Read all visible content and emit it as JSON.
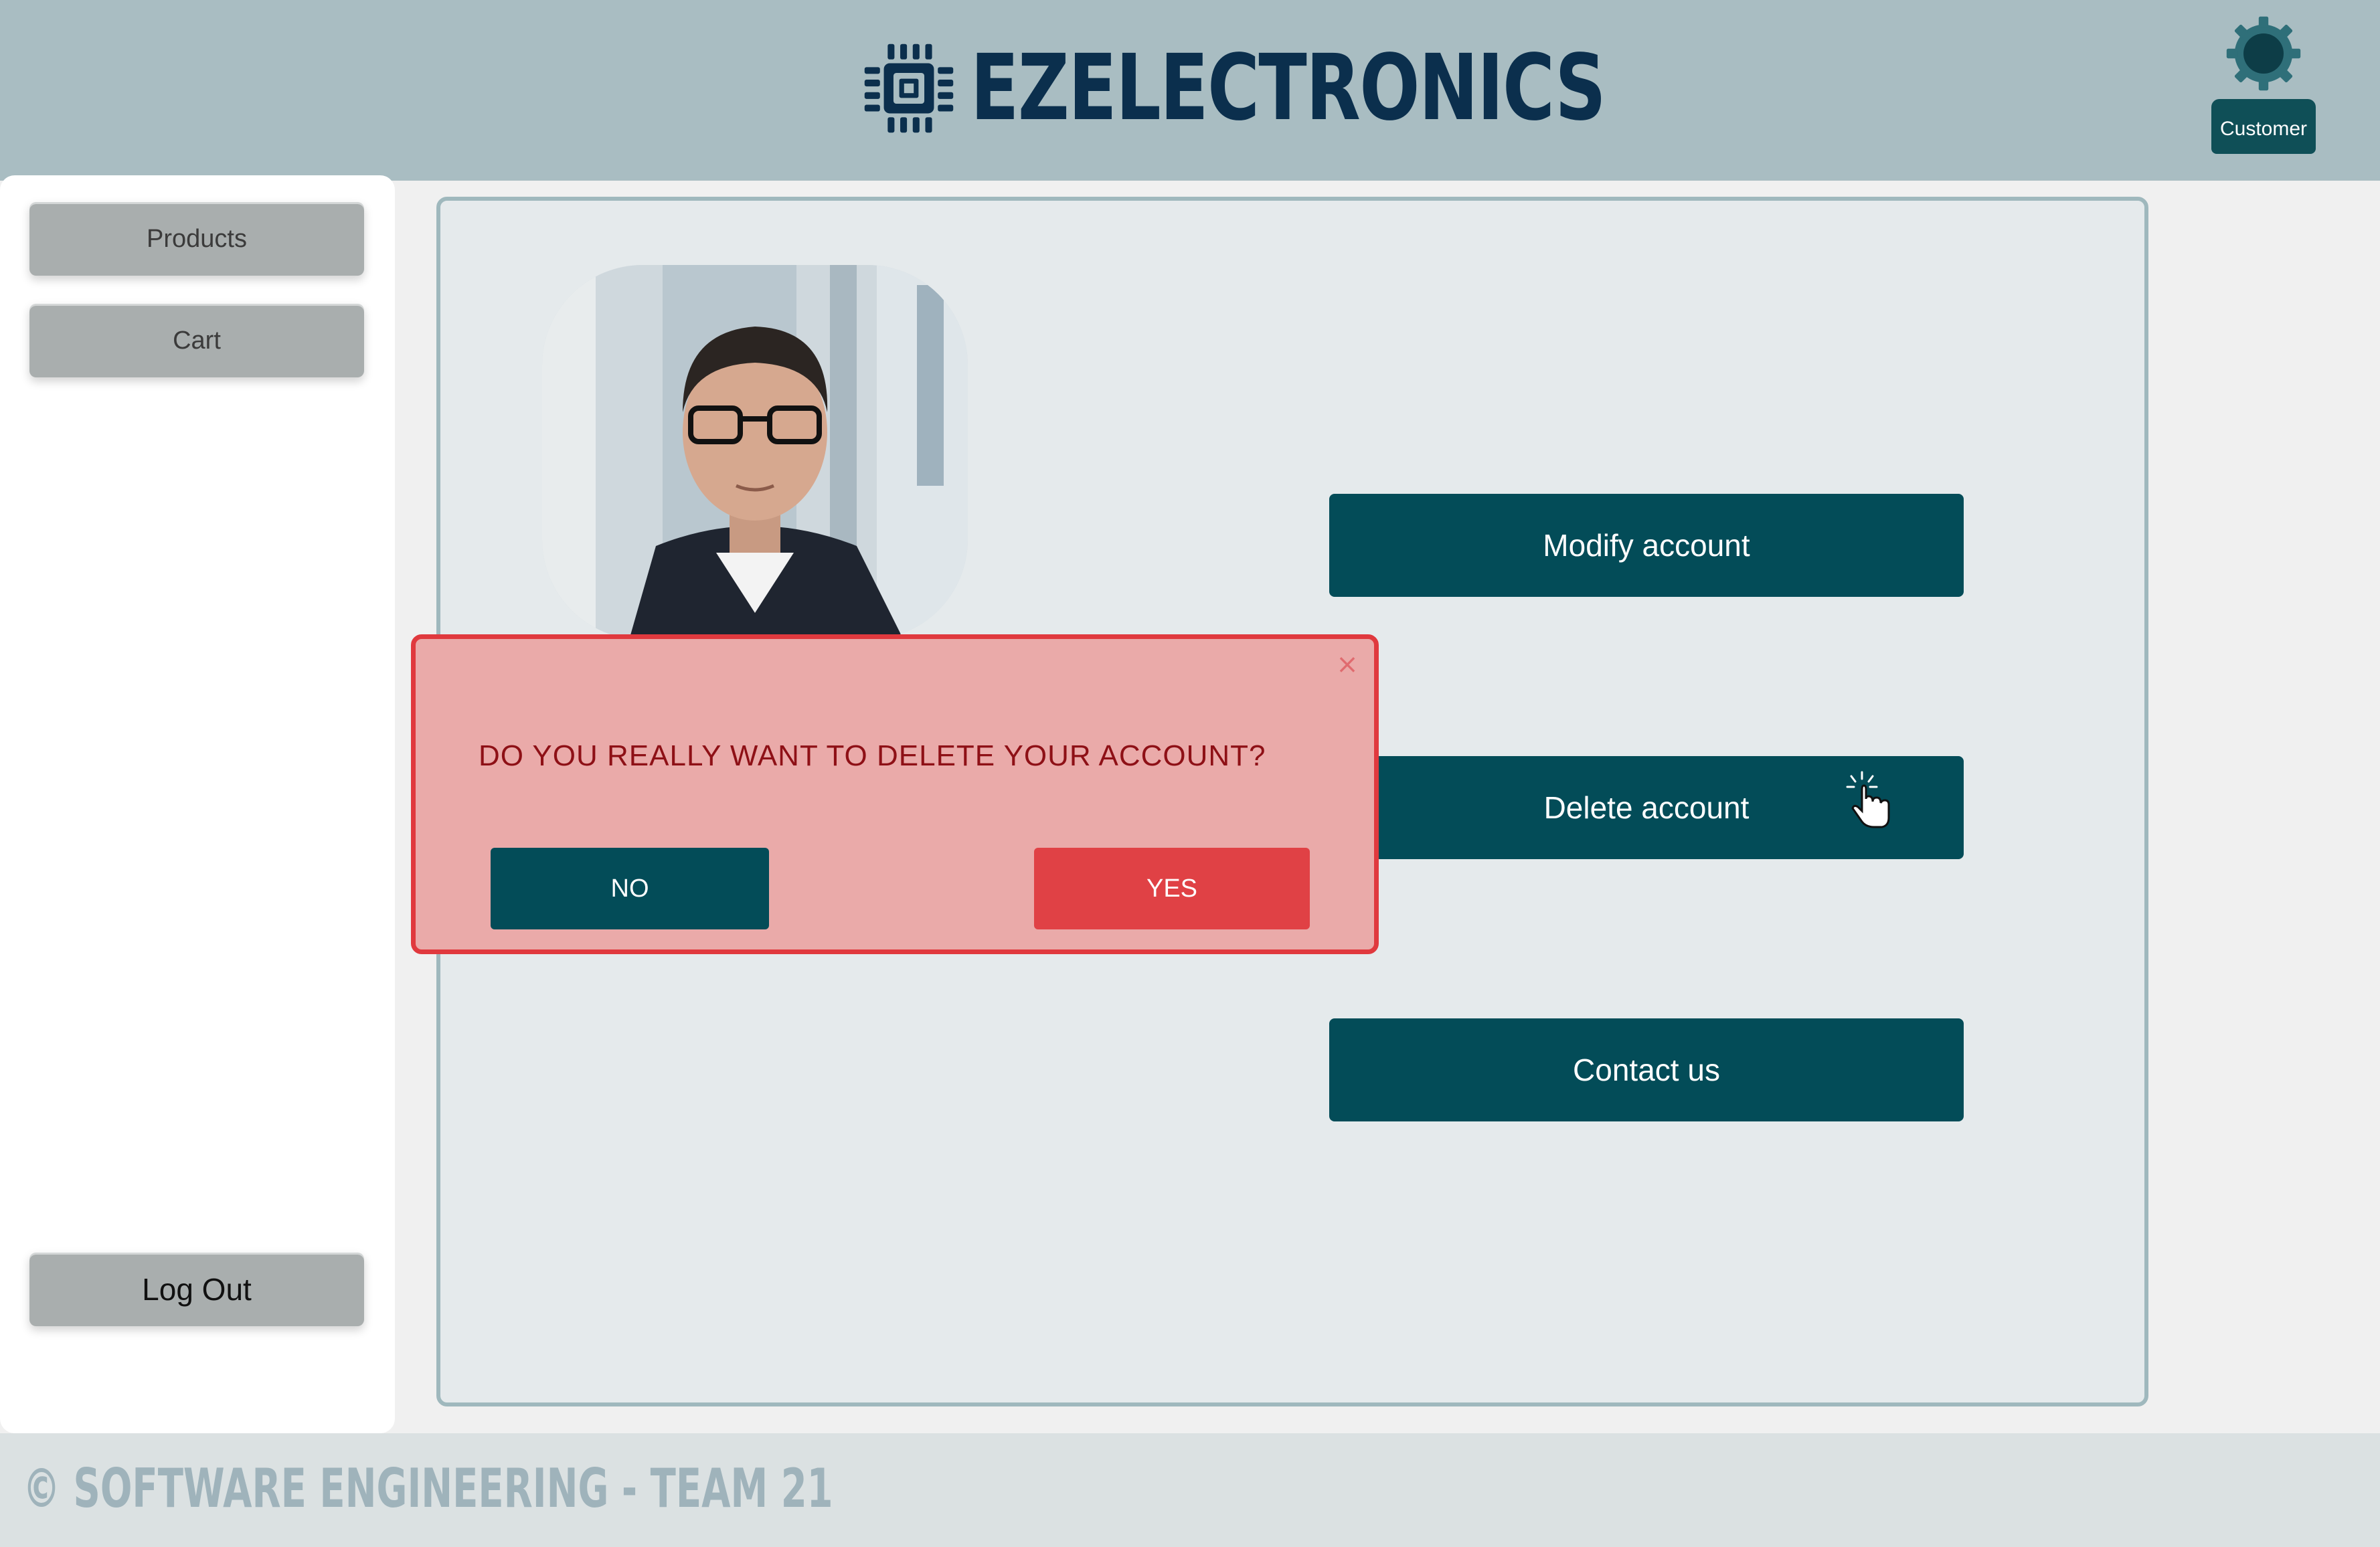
{
  "header": {
    "brand_name": "EZELECTRONICS",
    "logo_icon": "microchip-icon",
    "user_icon": "gear-user-icon",
    "user_role": "Customer"
  },
  "sidebar": {
    "items": [
      {
        "label": "Products"
      },
      {
        "label": "Cart"
      }
    ],
    "logout_label": "Log Out"
  },
  "main": {
    "avatar_alt": "profile-photo",
    "actions": [
      {
        "label": "Modify account"
      },
      {
        "label": "Delete account"
      },
      {
        "label": "Contact us"
      }
    ]
  },
  "modal": {
    "message": "DO YOU REALLY WANT TO DELETE YOUR ACCOUNT?",
    "no_label": "NO",
    "yes_label": "YES",
    "close_icon": "close-icon"
  },
  "footer": {
    "text": "© SOFTWARE ENGINEERING - TEAM 21"
  },
  "colors": {
    "header_bg": "#a9bdc2",
    "brand": "#0b2f4d",
    "primary_button": "#034c58",
    "danger": "#e04145",
    "modal_bg": "#eaaaa9"
  }
}
